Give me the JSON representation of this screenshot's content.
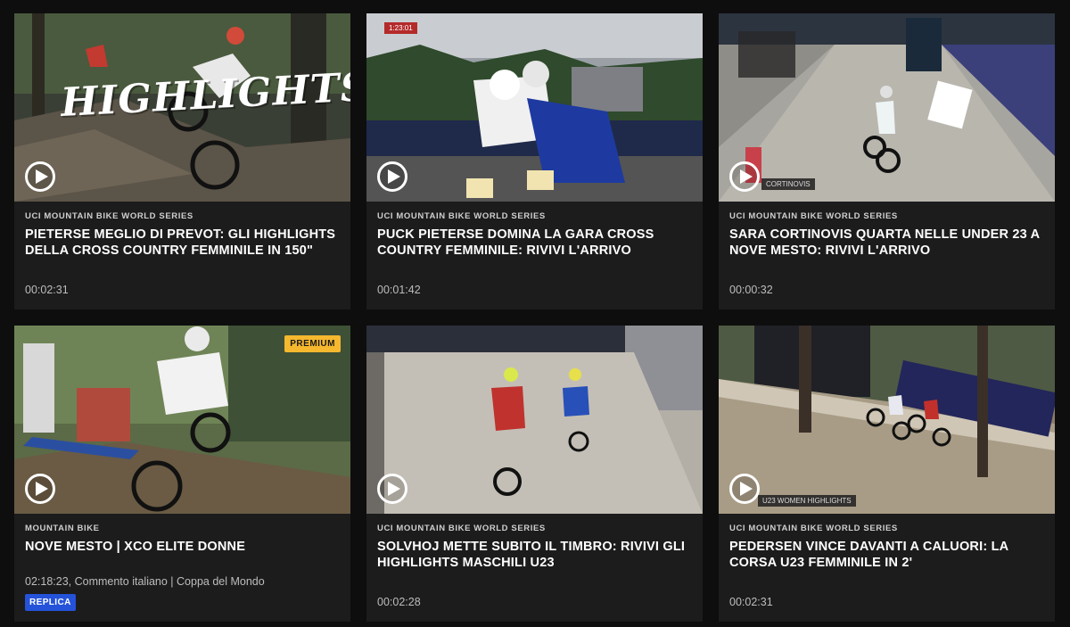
{
  "cards": [
    {
      "category": "UCI MOUNTAIN BIKE WORLD SERIES",
      "title": "PIETERSE MEGLIO DI PREVOT: GLI HIGHLIGHTS DELLA CROSS COUNTRY FEMMINILE IN 150\"",
      "duration": "00:02:31",
      "thumb_text": "HIGHLIGHTS"
    },
    {
      "category": "UCI MOUNTAIN BIKE WORLD SERIES",
      "title": "PUCK PIETERSE DOMINA LA GARA CROSS COUNTRY FEMMINILE: RIVIVI L'ARRIVO",
      "duration": "00:01:42",
      "thumb_text": "1:23:01"
    },
    {
      "category": "UCI MOUNTAIN BIKE WORLD SERIES",
      "title": "SARA CORTINOVIS QUARTA NELLE UNDER 23 A NOVE MESTO: RIVIVI L'ARRIVO",
      "duration": "00:00:32",
      "thumb_text": "CORTINOVIS"
    },
    {
      "category": "MOUNTAIN BIKE",
      "title": "NOVE MESTO | XCO ELITE DONNE",
      "meta": "02:18:23, Commento italiano | Coppa del Mondo",
      "badge": "PREMIUM",
      "tag": "REPLICA"
    },
    {
      "category": "UCI MOUNTAIN BIKE WORLD SERIES",
      "title": "SOLVHOJ METTE SUBITO IL TIMBRO: RIVIVI GLI HIGHLIGHTS MASCHILI U23",
      "duration": "00:02:28"
    },
    {
      "category": "UCI MOUNTAIN BIKE WORLD SERIES",
      "title": "PEDERSEN VINCE DAVANTI A CALUORI: LA CORSA U23 FEMMINILE IN 2'",
      "duration": "00:02:31",
      "thumb_text": "U23 WOMEN HIGHLIGHTS"
    }
  ],
  "colors": {
    "background": "#0e0e0e",
    "card": "#1c1c1c",
    "premium": "#f5b82e",
    "replica": "#2453d9"
  },
  "icons": {
    "play": "play-circle-icon"
  }
}
